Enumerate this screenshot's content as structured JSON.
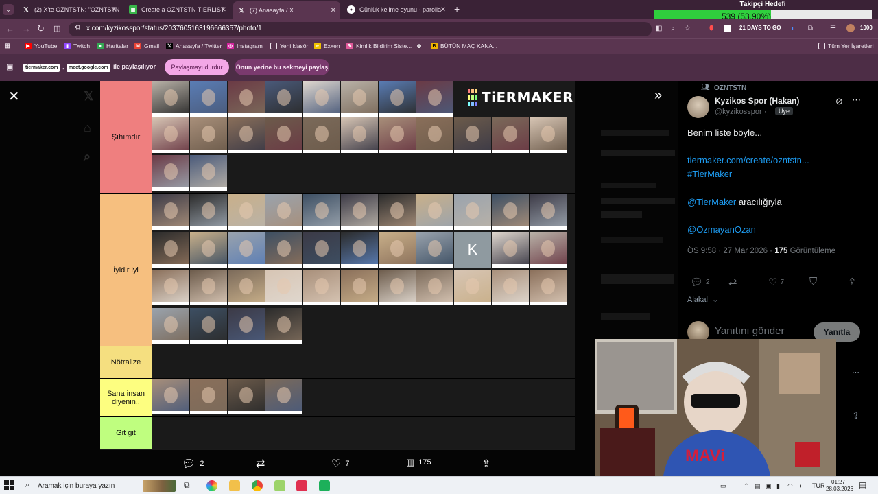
{
  "browser": {
    "tabs": [
      {
        "label": "(2) X'te OZNTSTN: \"OZNTSTN",
        "icon": "x-icon"
      },
      {
        "label": "Create a OZNTSTN TIERLIST",
        "icon": "tiermaker-icon"
      },
      {
        "label": "(7) Anasayfa / X",
        "icon": "x-icon",
        "active": true
      },
      {
        "label": "Günlük kelime oyunu - parolla",
        "icon": "parolla-icon"
      }
    ],
    "url": "x.com/kyzikosspor/status/2037605163196666357/photo/1",
    "bookmarks": [
      "YouTube",
      "Twitch",
      "Haritalar",
      "Gmail",
      "Anasayfa / Twitter",
      "Instagram",
      "Yeni klasör",
      "Exxen",
      "Kimlik Bildirim Siste...",
      "BÜTÜN MAÇ KANA..."
    ],
    "bookmarks_all": "Tüm Yer İşaretleri",
    "extension_badge": "21 DAYS TO GO",
    "extension_counter": "1000"
  },
  "follower_goal": {
    "title": "Takipçi Hedefi",
    "value_text": "539 (53.90%)",
    "fraction": 0.539,
    "color": "#2fcf3d"
  },
  "share_bar": {
    "chip1": "tiermaker.com",
    "separator": ",",
    "chip2": "meet.google.com",
    "text": "ile paylaşılıyor",
    "stop_button": "Paylaşmayı durdur",
    "share_tab_button": "Onun yerine bu sekmeyi paylaş"
  },
  "tierlist": {
    "logo_text": "TiERMAKER",
    "tiers": [
      {
        "label": "Şıhımdır",
        "color": "#ef7f7f"
      },
      {
        "label": "İyidir iyi",
        "color": "#f6bf7f"
      },
      {
        "label": "Nötralize",
        "color": "#f5df80"
      },
      {
        "label": "Sana insan diyenin..",
        "color": "#fdfe80"
      },
      {
        "label": "Git git",
        "color": "#bffe7f"
      }
    ],
    "k_tile": "K"
  },
  "actions": {
    "replies": "2",
    "likes": "7",
    "views": "175"
  },
  "tweet": {
    "community": "OZNTSTN",
    "author_name": "Kyzikos Spor (Hakan)",
    "author_handle": "@kyzikosspor",
    "separator": "·",
    "member_badge": "Üye",
    "line1": "Benim liste böyle...",
    "link": "tiermaker.com/create/ozntstn...",
    "hashtag": "#TierMaker",
    "mention1": "@TierMaker",
    "mention1_suffix": " aracılığıyla",
    "mention2": "@OzmayanOzan",
    "time": "ÖS 9:58 · 27 Mar 2026 · ",
    "views_count": "175",
    "views_label": " Görüntüleme",
    "reply_count": "2",
    "like_count": "7",
    "sort_label": "Alakalı",
    "reply_placeholder": "Yanıtını gönder",
    "reply_button": "Yanıtla"
  },
  "taskbar": {
    "search_placeholder": "Aramak için buraya yazın",
    "language": "TUR",
    "time": "01:27",
    "date": "28.03.2026"
  }
}
